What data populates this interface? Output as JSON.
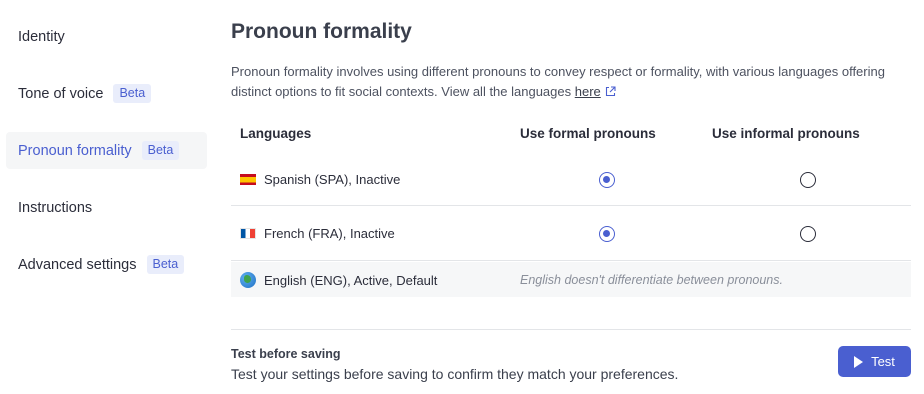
{
  "sidebar": {
    "items": [
      {
        "label": "Identity",
        "badge": ""
      },
      {
        "label": "Tone of voice",
        "badge": "Beta"
      },
      {
        "label": "Pronoun formality",
        "badge": "Beta",
        "active": true
      },
      {
        "label": "Instructions",
        "badge": ""
      },
      {
        "label": "Advanced settings",
        "badge": "Beta"
      }
    ]
  },
  "main": {
    "title": "Pronoun formality",
    "description": "Pronoun formality involves using different pronouns to convey respect or formality, with various languages offering distinct options to fit social contexts. View all the languages",
    "link_text": "here",
    "table": {
      "headers": [
        "Languages",
        "Use formal pronouns",
        "Use informal pronouns"
      ],
      "rows": [
        {
          "flag": "spain-flag-icon",
          "language": "Spanish (SPA), Inactive",
          "formal": true,
          "informal": false
        },
        {
          "flag": "france-flag-icon",
          "language": "French (FRA), Inactive",
          "formal": true,
          "informal": false
        },
        {
          "flag": "globe-icon",
          "language": "English (ENG), Active, Default",
          "note": "English doesn't differentiate between pronouns."
        }
      ]
    },
    "test": {
      "title": "Test before saving",
      "description": "Test your settings before saving to confirm they match your preferences.",
      "button_label": "Test"
    }
  },
  "colors": {
    "accent": "#4a5fd0",
    "badge_bg": "#e9edfb",
    "active_bg": "#f5f6f7"
  }
}
